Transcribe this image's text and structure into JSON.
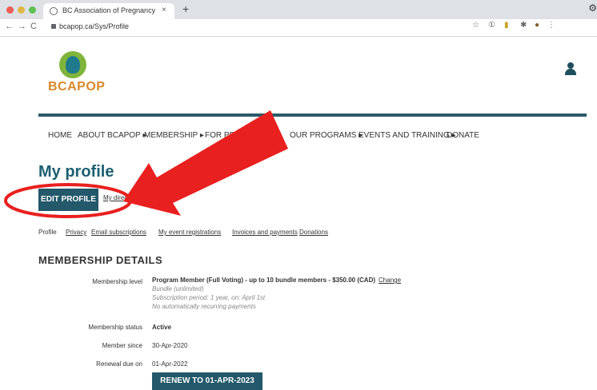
{
  "browser": {
    "tab_title": "BC Association of Pregnancy C",
    "tab_close": "×",
    "new_tab": "+",
    "url": "bcapop.ca/Sys/Profile",
    "corner": "⚙"
  },
  "site": {
    "logo_text": "BCAPOP",
    "menu": [
      "HOME",
      "ABOUT BCAPOP ▸",
      "MEMBERSHIP ▸",
      "FOR PRO",
      "OUR PROGRAMS ▸",
      "EVENTS AND TRAINING ▸",
      "DONATE"
    ]
  },
  "page": {
    "title": "My profile",
    "edit_button": "EDIT PROFILE",
    "directory_link": "My directory profile",
    "subtabs": [
      "Profile",
      "Privacy",
      "Email subscriptions",
      "My event registrations",
      "Invoices and payments",
      "Donations"
    ],
    "section_title": "MEMBERSHIP DETAILS"
  },
  "membership": {
    "level_label": "Membership level",
    "level_value": "Program Member (Full Voting) - up to 10 bundle members - $350.00 (CAD)",
    "change_link": "Change",
    "bundle": "Bundle (unlimited)",
    "subscription_period": "Subscription period: 1 year, on: April 1st",
    "recurring": "No automatically recurring payments",
    "status_label": "Membership status",
    "status_value": "Active",
    "since_label": "Member since",
    "since_value": "30-Apr-2020",
    "renewal_label": "Renewal due on",
    "renewal_value": "01-Apr-2022",
    "renew_button": "RENEW TO 01-APR-2023"
  },
  "colors": {
    "primary": "#23596a",
    "annotation": "#e8201f",
    "logo_orange": "#d9882a",
    "logo_green": "#7fb53a"
  }
}
